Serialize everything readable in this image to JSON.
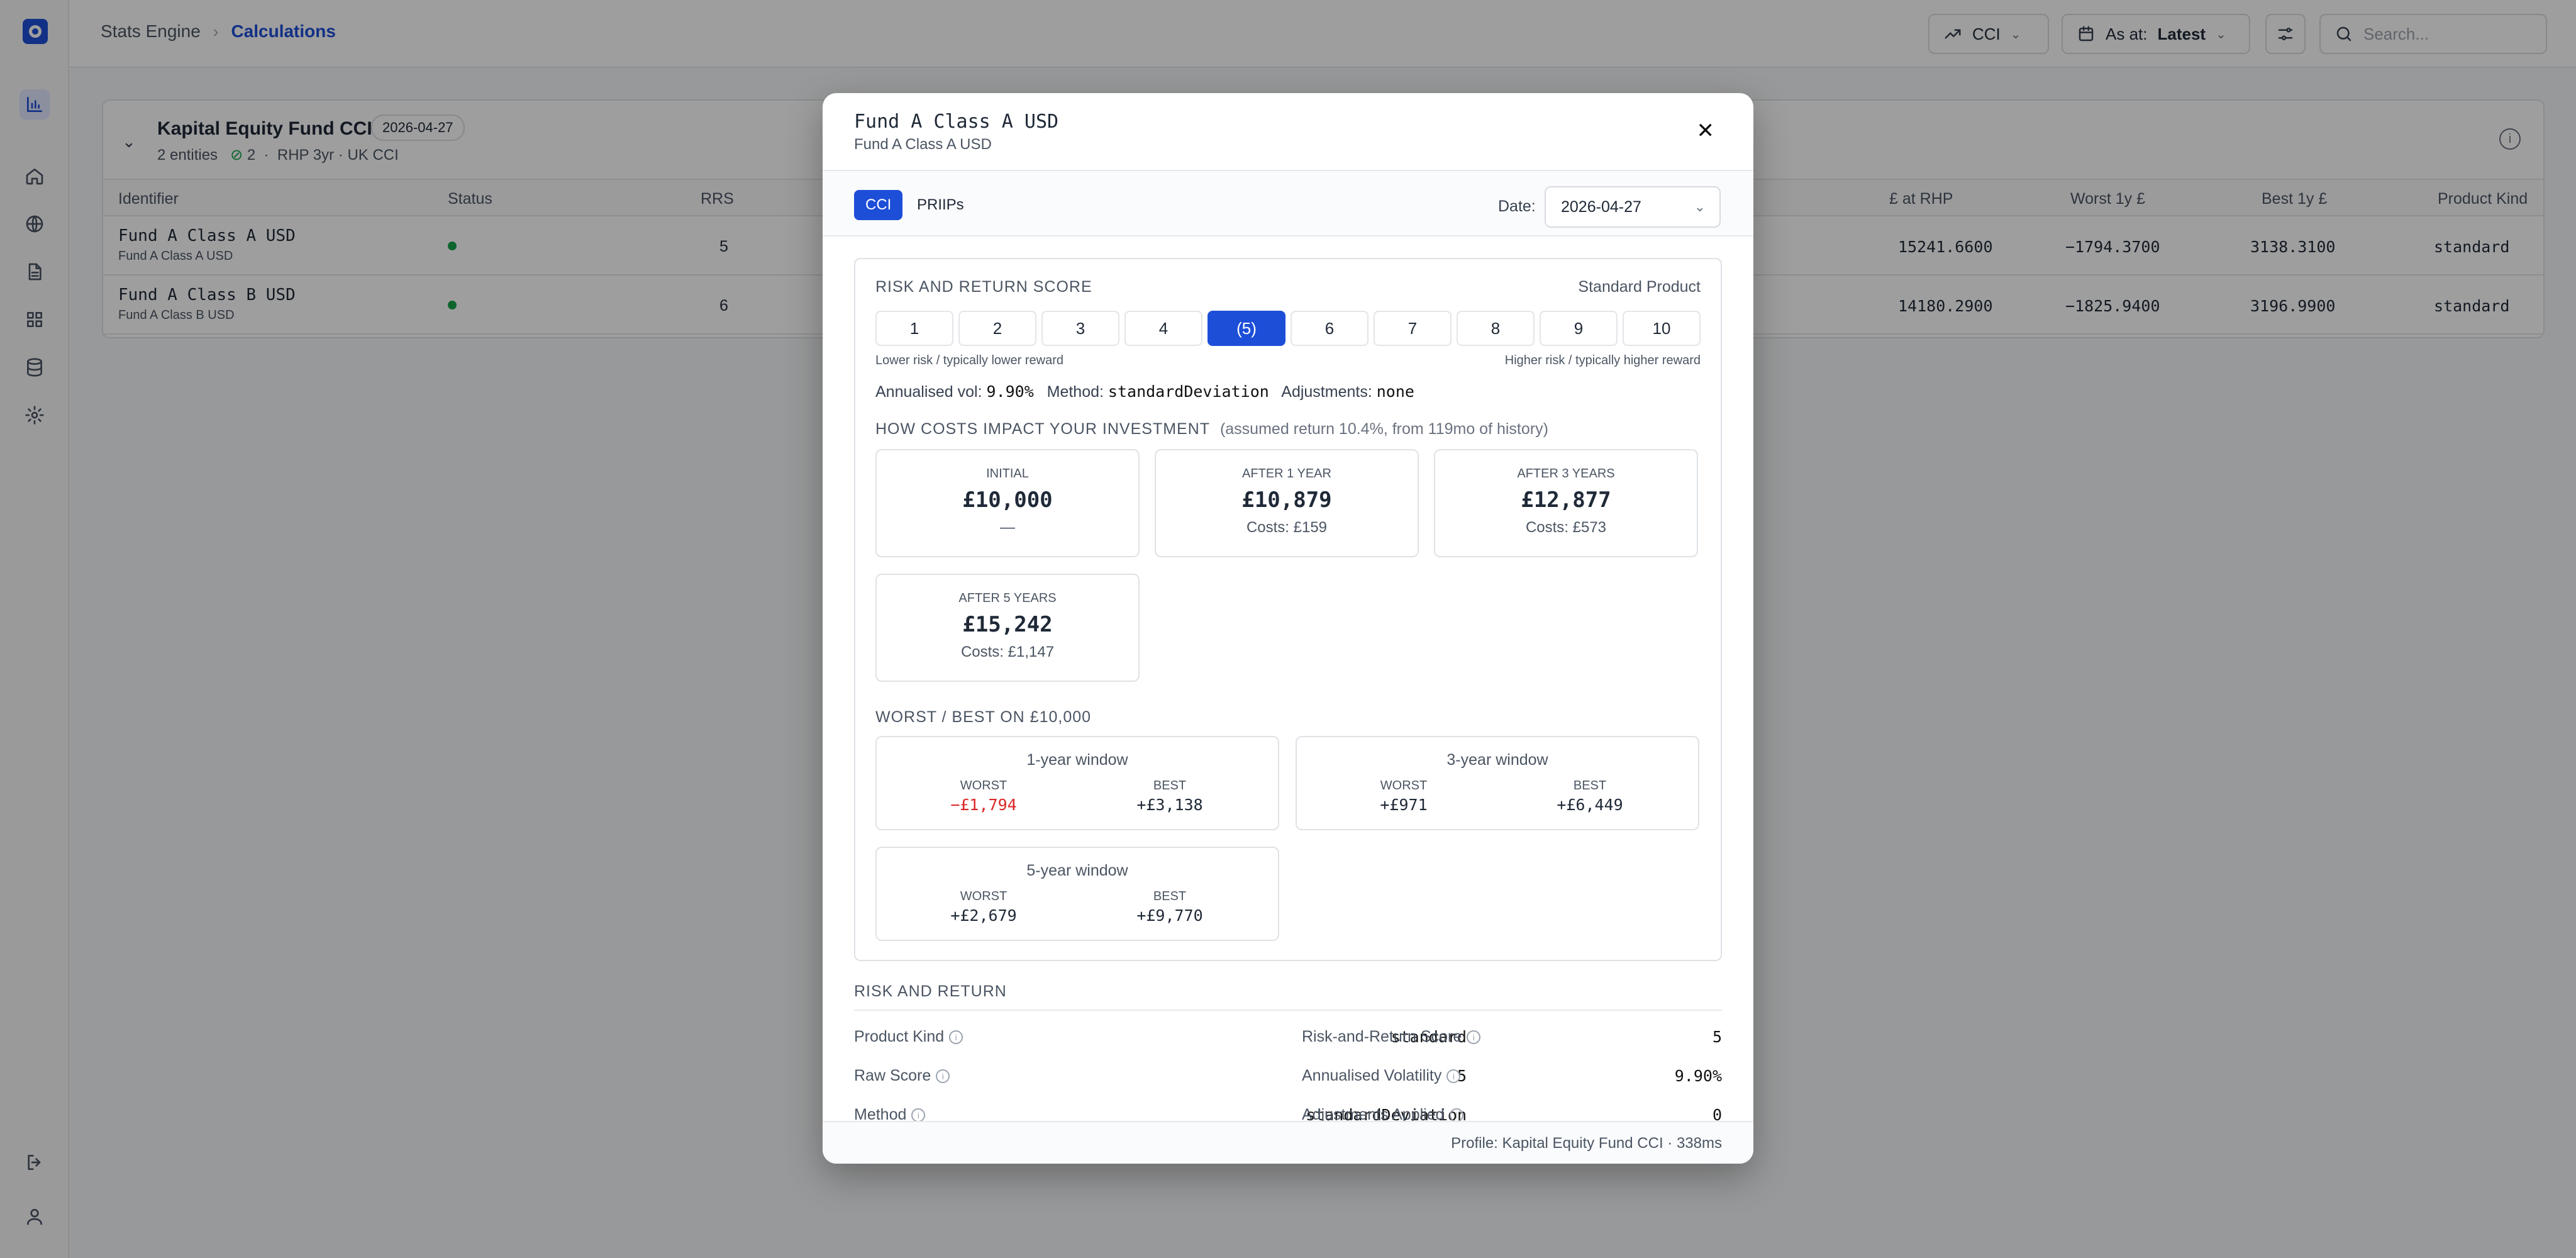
{
  "breadcrumbs": [
    "Stats Engine",
    "Calculations"
  ],
  "header": {
    "metric_label": "CCI",
    "asat_prefix": "As at:",
    "asat_value": "Latest",
    "search_placeholder": "Search..."
  },
  "card": {
    "title": "Kapital Equity Fund CCI",
    "date": "2026-04-27",
    "entities": "2 entities",
    "ok_count": "2",
    "meta": "RHP 3yr · UK CCI"
  },
  "table": {
    "headers": [
      "Identifier",
      "Status",
      "RRS",
      "£ at RHP",
      "Worst 1y £",
      "Best 1y £",
      "Product Kind"
    ],
    "rows": [
      {
        "name": "Fund A Class A USD",
        "sub": "Fund A Class A USD",
        "rrs": "5",
        "at_rhp": "15241.6600",
        "worst": "−1794.3700",
        "best": "3138.3100",
        "kind": "standard"
      },
      {
        "name": "Fund A Class B USD",
        "sub": "Fund A Class B USD",
        "rrs": "6",
        "at_rhp": "14180.2900",
        "worst": "−1825.9400",
        "best": "3196.9900",
        "kind": "standard"
      }
    ]
  },
  "modal": {
    "title": "Fund A Class A USD",
    "subtitle": "Fund A Class A USD",
    "tabs": [
      "CCI",
      "PRIIPs"
    ],
    "date_label": "Date:",
    "date_value": "2026-04-27",
    "risk": {
      "heading": "RISK AND RETURN SCORE",
      "product": "Standard Product",
      "scale": [
        "1",
        "2",
        "3",
        "4",
        "(5)",
        "6",
        "7",
        "8",
        "9",
        "10"
      ],
      "selected_index": 4,
      "low": "Lower risk / typically lower reward",
      "high": "Higher risk / typically higher reward",
      "vol_label": "Annualised vol:",
      "vol_value": "9.90%",
      "method_label": "Method:",
      "method_value": "standardDeviation",
      "adj_label": "Adjustments:",
      "adj_value": "none"
    },
    "costs": {
      "heading": "HOW COSTS IMPACT YOUR INVESTMENT",
      "note": "(assumed return 10.4%, from 119mo of history)",
      "items": [
        {
          "label": "INITIAL",
          "amount": "£10,000",
          "sub": "—"
        },
        {
          "label": "AFTER 1 YEAR",
          "amount": "£10,879",
          "sub": "Costs: £159"
        },
        {
          "label": "AFTER 3 YEARS",
          "amount": "£12,877",
          "sub": "Costs: £573"
        },
        {
          "label": "AFTER 5 YEARS",
          "amount": "£15,242",
          "sub": "Costs: £1,147"
        }
      ]
    },
    "windows": {
      "heading": "WORST / BEST ON £10,000",
      "worst_label": "WORST",
      "best_label": "BEST",
      "items": [
        {
          "title": "1-year window",
          "worst": "−£1,794",
          "best": "+£3,138"
        },
        {
          "title": "3-year window",
          "worst": "+£971",
          "best": "+£6,449"
        },
        {
          "title": "5-year window",
          "worst": "+£2,679",
          "best": "+£9,770"
        }
      ]
    },
    "rr": {
      "heading": "RISK AND RETURN",
      "rows": [
        {
          "label": "Product Kind",
          "value": "standard"
        },
        {
          "label": "Risk-and-Return Score",
          "value": "5"
        },
        {
          "label": "Raw Score",
          "value": "5"
        },
        {
          "label": "Annualised Volatility",
          "value": "9.90%"
        },
        {
          "label": "Method",
          "value": "standardDeviation"
        },
        {
          "label": "Adjustments Applied",
          "value": "0"
        }
      ]
    },
    "footer": "Profile: Kapital Equity Fund CCI · 338ms"
  },
  "colors": {
    "accent": "#1d4ed8",
    "negative": "#dc2626",
    "ok": "#16a34a"
  }
}
